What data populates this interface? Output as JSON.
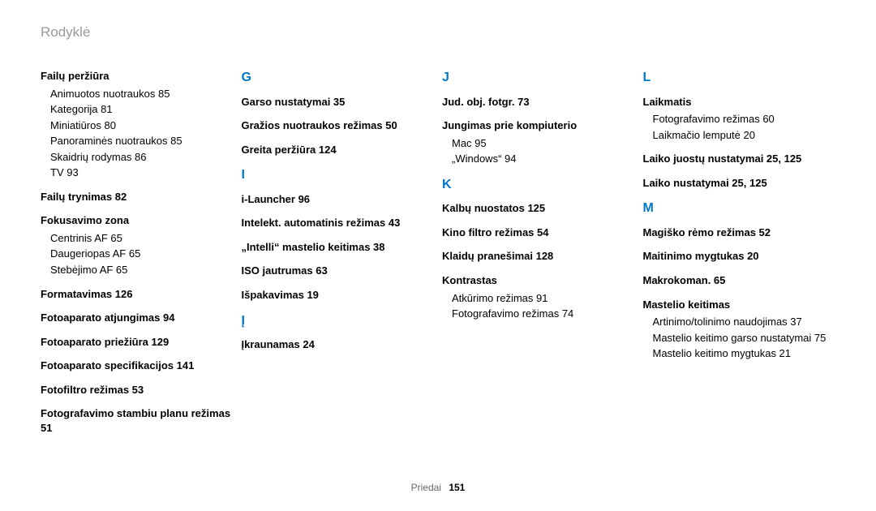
{
  "title": "Rodyklė",
  "footer": {
    "section": "Priedai",
    "page": "151"
  },
  "columns": [
    [
      {
        "type": "group",
        "head": "Failų peržiūra",
        "subs": [
          "Animuotos nuotraukos  85",
          "Kategorija  81",
          "Miniatiūros  80",
          "Panoraminės nuotraukos  85",
          "Skaidrių rodymas  86",
          "TV  93"
        ]
      },
      {
        "type": "entry",
        "text": "Failų trynimas  82"
      },
      {
        "type": "group",
        "head": "Fokusavimo zona",
        "subs": [
          "Centrinis AF  65",
          "Daugeriopas AF  65",
          "Stebėjimo AF  65"
        ]
      },
      {
        "type": "entry",
        "text": "Formatavimas  126"
      },
      {
        "type": "entry",
        "text": "Fotoaparato atjungimas  94"
      },
      {
        "type": "entry",
        "text": "Fotoaparato priežiūra  129"
      },
      {
        "type": "entry",
        "text": "Fotoaparato specifikacijos  141"
      },
      {
        "type": "entry",
        "text": "Fotofiltro režimas  53"
      },
      {
        "type": "entry",
        "text": "Fotografavimo stambiu planu režimas  51"
      }
    ],
    [
      {
        "type": "letter",
        "text": "G"
      },
      {
        "type": "entry",
        "text": "Garso nustatymai  35"
      },
      {
        "type": "entry",
        "text": "Gražios nuotraukos režimas  50"
      },
      {
        "type": "entry",
        "text": "Greita peržiūra  124"
      },
      {
        "type": "letter",
        "text": "I"
      },
      {
        "type": "entry",
        "text": "i-Launcher  96"
      },
      {
        "type": "entry",
        "text": "Intelekt. automatinis režimas  43"
      },
      {
        "type": "entry",
        "text": "„Intelli“ mastelio keitimas  38"
      },
      {
        "type": "entry",
        "text": "ISO jautrumas  63"
      },
      {
        "type": "entry",
        "text": "Išpakavimas  19"
      },
      {
        "type": "letter",
        "text": "Į"
      },
      {
        "type": "entry",
        "text": "Įkraunamas  24"
      }
    ],
    [
      {
        "type": "letter",
        "text": "J"
      },
      {
        "type": "entry",
        "text": "Jud. obj. fotgr.  73"
      },
      {
        "type": "group",
        "head": "Jungimas prie kompiuterio",
        "subs": [
          "Mac  95",
          "„Windows“  94"
        ]
      },
      {
        "type": "letter",
        "text": "K"
      },
      {
        "type": "entry",
        "text": "Kalbų nuostatos  125"
      },
      {
        "type": "entry",
        "text": "Kino filtro režimas  54"
      },
      {
        "type": "entry",
        "text": "Klaidų pranešimai  128"
      },
      {
        "type": "group",
        "head": "Kontrastas",
        "subs": [
          "Atkūrimo režimas  91",
          "Fotografavimo režimas  74"
        ]
      }
    ],
    [
      {
        "type": "letter",
        "text": "L"
      },
      {
        "type": "group",
        "head": "Laikmatis",
        "subs": [
          "Fotografavimo režimas  60",
          "Laikmačio lemputė  20"
        ]
      },
      {
        "type": "entry",
        "text": "Laiko juostų nustatymai  25, 125"
      },
      {
        "type": "entry",
        "text": "Laiko nustatymai  25, 125"
      },
      {
        "type": "letter",
        "text": "M"
      },
      {
        "type": "entry",
        "text": "Magiško rėmo režimas  52"
      },
      {
        "type": "entry",
        "text": "Maitinimo mygtukas  20"
      },
      {
        "type": "entry",
        "text": "Makrokoman.  65"
      },
      {
        "type": "group",
        "head": "Mastelio keitimas",
        "subs": [
          "Artinimo/tolinimo naudojimas  37",
          "Mastelio keitimo garso nustatymai  75",
          "Mastelio keitimo mygtukas  21"
        ]
      }
    ]
  ]
}
